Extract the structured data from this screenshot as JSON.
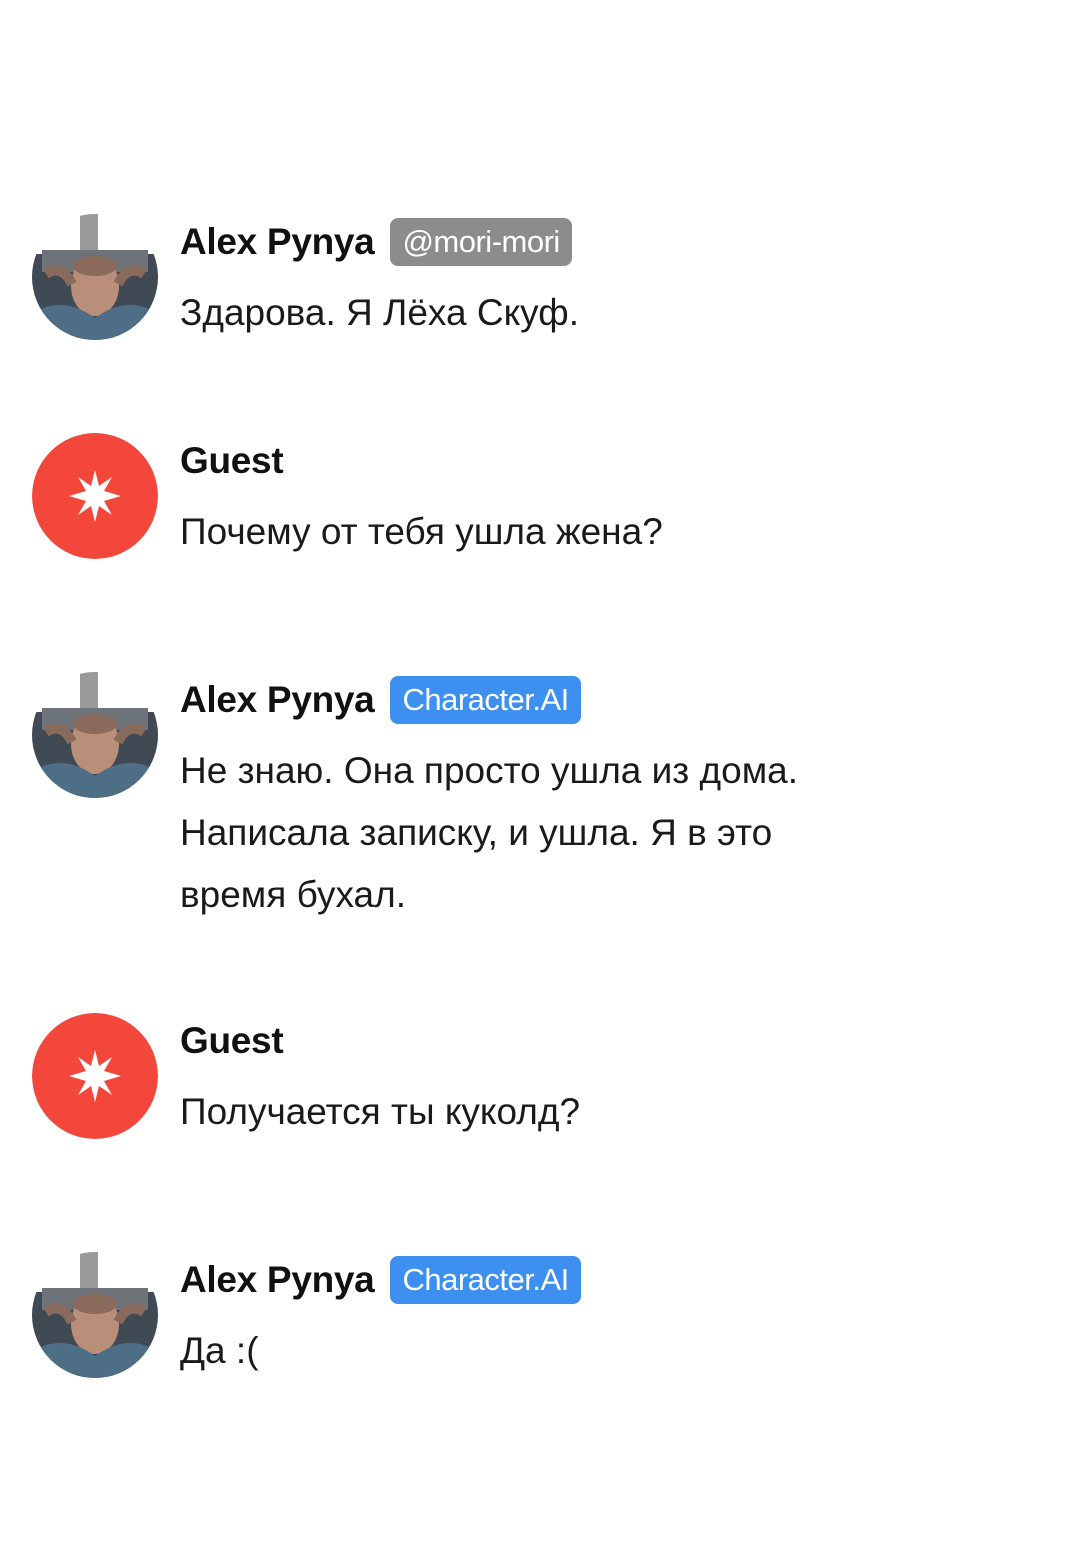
{
  "colors": {
    "guest_avatar": "#f2473a",
    "ai_badge": "#3d8ff0",
    "user_badge": "#8c8c8c"
  },
  "messages": [
    {
      "author": "Alex Pynya",
      "badge": "@mori-mori",
      "badge_kind": "user",
      "avatar": "person-photo-avatar",
      "text": "Здарова. Я Лёха Скуф."
    },
    {
      "author": "Guest",
      "avatar": "guest-star-avatar",
      "text": "Почему от тебя ушла жена?"
    },
    {
      "author": "Alex Pynya",
      "badge": "Character.AI",
      "badge_kind": "ai",
      "avatar": "person-photo-avatar",
      "text": "Не знаю. Она просто ушла из дома.\nНаписала записку, и ушла. Я в это\nвремя бухал."
    },
    {
      "author": "Guest",
      "avatar": "guest-star-avatar",
      "text": "Получается ты куколд?"
    },
    {
      "author": "Alex Pynya",
      "badge": "Character.AI",
      "badge_kind": "ai",
      "avatar": "person-photo-avatar",
      "text": "Да :("
    }
  ]
}
